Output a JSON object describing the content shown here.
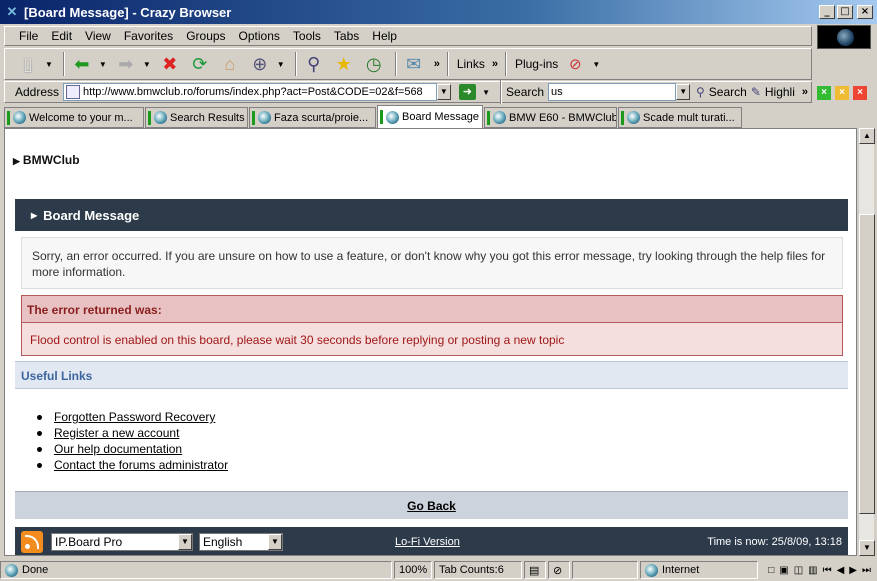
{
  "window": {
    "title": "[Board Message] - Crazy Browser"
  },
  "menu": [
    "File",
    "Edit",
    "View",
    "Favorites",
    "Groups",
    "Options",
    "Tools",
    "Tabs",
    "Help"
  ],
  "toolbar": {
    "links_label": "Links",
    "plugins_label": "Plug-ins"
  },
  "address": {
    "label": "Address",
    "url": "http://www.bmwclub.ro/forums/index.php?act=Post&CODE=02&f=568",
    "search_label": "Search",
    "search_value": "us",
    "search_button": "Search",
    "highlight_button": "Highli"
  },
  "tabs": [
    {
      "label": "Welcome to your m..."
    },
    {
      "label": "Search Results"
    },
    {
      "label": "Faza scurta/proie..."
    },
    {
      "label": "Board Message"
    },
    {
      "label": "BMW E60 - BMWClub"
    },
    {
      "label": "Scade mult turati..."
    }
  ],
  "page": {
    "site_name": "BMWClub",
    "header": "Board Message",
    "info": "Sorry, an error occurred. If you are unsure on how to use a feature, or don't know why you got this error message, try looking through the help files for more information.",
    "error_title": "The error returned was:",
    "error_message": "Flood control is enabled on this board, please wait 30 seconds before replying or posting a new topic",
    "useful_links_title": "Useful Links",
    "links": [
      "Forgotten Password Recovery",
      "Register a new account",
      "Our help documentation",
      "Contact the forums administrator"
    ],
    "go_back": "Go Back",
    "footer": {
      "skin": "IP.Board Pro",
      "language": "English",
      "lofi": "Lo-Fi Version",
      "time": "Time is now: 25/8/09, 13:18"
    }
  },
  "status": {
    "text": "Done",
    "zoom": "100%",
    "tab_count": "Tab Counts:6",
    "zone": "Internet"
  },
  "colors": {
    "header_bg": "#2c3a4a",
    "error_bg": "#f5dede",
    "error_text": "#a01818",
    "useful_text": "#3c66a0"
  }
}
